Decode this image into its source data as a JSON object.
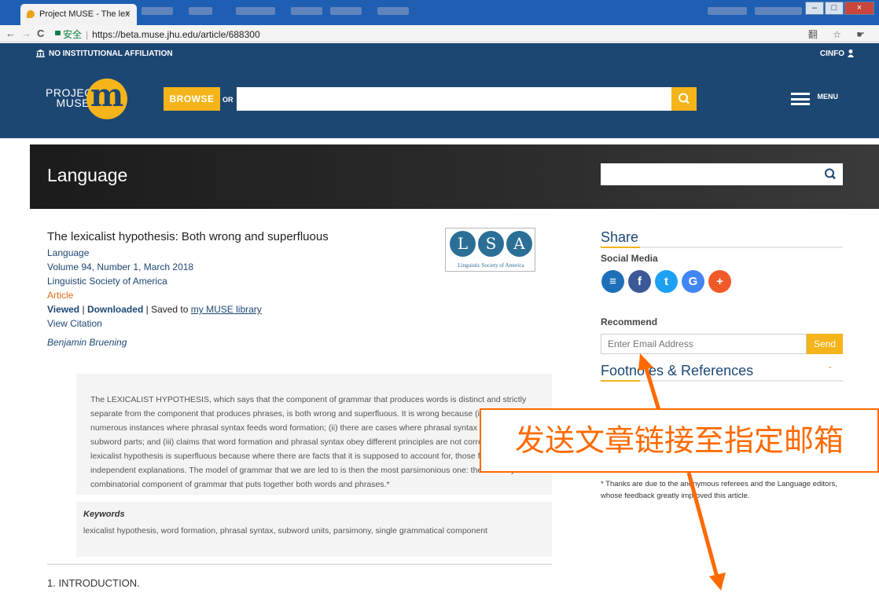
{
  "browser": {
    "tab_title": "Project MUSE - The lex",
    "tab_close": "×",
    "back": "←",
    "forward": "→",
    "reload": "C",
    "secure_label": "安全",
    "url": "https://beta.muse.jhu.edu/article/688300",
    "toolbar_icons": "翻 ☆ ☛"
  },
  "header": {
    "affiliation": "NO INSTITUTIONAL AFFILIATION",
    "account": "CINFO",
    "logo_text_top": "PROJECT",
    "logo_text_bottom": "MUSE",
    "logo_mark": "m",
    "browse_label": "BROWSE",
    "or_label": "OR",
    "search_value": "",
    "menu_label": "MENU"
  },
  "journal": {
    "title": "Language",
    "search_value": ""
  },
  "article": {
    "title": "The lexicalist hypothesis: Both wrong and superfluous",
    "journal": "Language",
    "issue": "Volume 94, Number 1, March 2018",
    "publisher": "Linguistic Society of America",
    "type": "Article",
    "viewed": "Viewed",
    "pipe1": " | ",
    "downloaded": "Downloaded",
    "saved_prefix": " | Saved to ",
    "library_link": "my MUSE library",
    "view_citation": "View Citation",
    "author": "Benjamin Bruening"
  },
  "lsa": {
    "letters": [
      "L",
      "S",
      "A"
    ],
    "caption": "Linguistic Society of America"
  },
  "abstract": {
    "text": "The LEXICALIST HYPOTHESIS, which says that the component of grammar that produces words is distinct and strictly separate from the component that produces phrases, is both wrong and superfluous. It is wrong because (i) there are numerous instances where phrasal syntax feeds word formation; (ii) there are cases where phrasal syntax can access subword parts; and (iii) claims that word formation and phrasal syntax obey different principles are not correct. The lexicalist hypothesis is superfluous because where there are facts that it is supposed to account for, those facts have independent explanations. The model of grammar that we are led to is then the most parsimonious one: there is only one combinatorial component of grammar that puts together both words and phrases.*"
  },
  "keywords": {
    "title": "Keywords",
    "text": "lexicalist hypothesis, word formation, phrasal syntax, subword units, parsimony, single grammatical component"
  },
  "intro": "1. INTRODUCTION.",
  "sidebar": {
    "share_title": "Share",
    "social_media_label": "Social Media",
    "social_icons": [
      {
        "name": "list",
        "glyph": "≡",
        "color": "#1d6fb8"
      },
      {
        "name": "facebook",
        "glyph": "f",
        "color": "#3b5998"
      },
      {
        "name": "twitter",
        "glyph": "t",
        "color": "#1da1f2"
      },
      {
        "name": "google",
        "glyph": "G",
        "color": "#4285f4"
      },
      {
        "name": "more",
        "glyph": "+",
        "color": "#f05a28"
      }
    ],
    "recommend_label": "Recommend",
    "email_placeholder": "Enter Email Address",
    "send_label": "Send",
    "footnotes_title": "Footnotes & References",
    "footnotes_chevron": "ˇ",
    "thanks_text": "* Thanks are due to the anonymous referees and the Language editors, whose feedback greatly improved this article."
  },
  "annotation": {
    "text": "发送文章链接至指定邮箱",
    "color": "#ff6a00"
  }
}
